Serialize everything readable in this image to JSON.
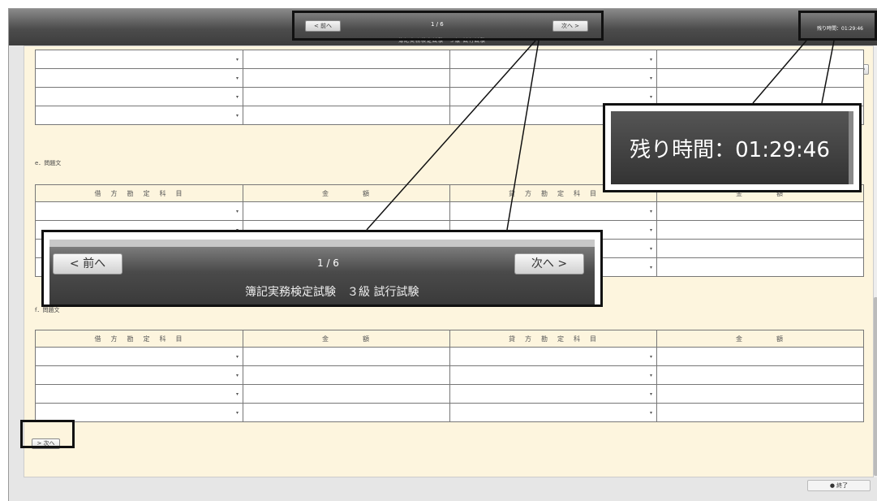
{
  "header": {
    "prev_label": "< 前へ",
    "next_label": "次へ >",
    "page_indicator": "1 / 6",
    "subtitle": "簿記実務検定試験　３級 試行試験",
    "timer": "残り時間：01:29:46"
  },
  "zoom": {
    "zoom_in": "+",
    "zoom_out": "−",
    "reset": "↻"
  },
  "questions": {
    "e_label": "e．問題文",
    "f_label": "f．問題文"
  },
  "table_headers": {
    "debit_account": "借　方　勘　定　科　目",
    "amount": "金　　　　額",
    "credit_account": "貸　方　勘　定　科　目",
    "amount2": "金　　　　額"
  },
  "dropdown_arrow": "▾",
  "next_question_label": "> 次へ",
  "end_label": "終了",
  "callouts": {
    "timer_text": "残り時間：01:29:46",
    "nav_prev": "< 前へ",
    "nav_next": "次へ >",
    "nav_page": "1 / 6",
    "nav_subtitle": "簿記実務検定試験　３級 試行試験"
  }
}
